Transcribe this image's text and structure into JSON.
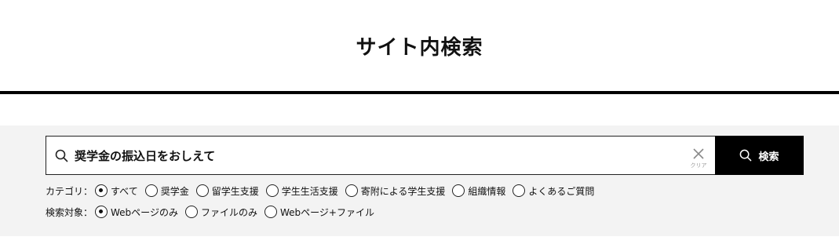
{
  "page": {
    "title": "サイト内検索"
  },
  "search": {
    "query": "奨学金の振込日をおしえて",
    "clear_label": "クリア",
    "submit_label": "検索",
    "icons": {
      "search": "search-icon",
      "clear": "close-icon"
    }
  },
  "filters": {
    "category": {
      "label": "カテゴリ：",
      "selected": "すべて",
      "options": [
        "すべて",
        "奨学金",
        "留学生支援",
        "学生生活支援",
        "寄附による学生支援",
        "組織情報",
        "よくあるご質問"
      ]
    },
    "target": {
      "label": "検索対象：",
      "selected": "Webページのみ",
      "options": [
        "Webページのみ",
        "ファイルのみ",
        "Webページ+ファイル"
      ]
    }
  },
  "colors": {
    "panel_bg": "#f3f3f3",
    "button_bg": "#000000",
    "rule": "#000000"
  }
}
